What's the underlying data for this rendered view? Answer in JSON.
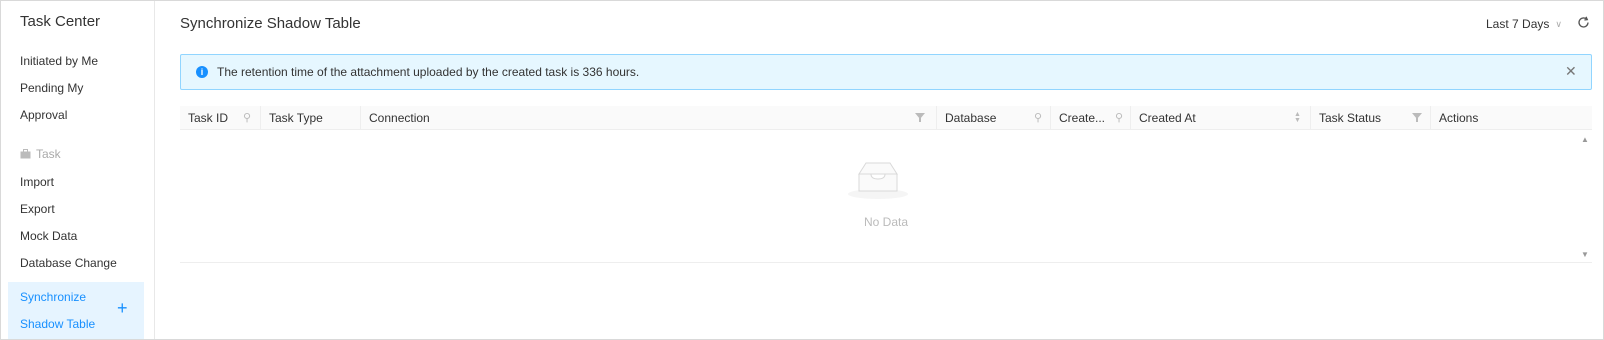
{
  "sidebar": {
    "title": "Task Center",
    "items": [
      {
        "label": "Initiated by Me"
      },
      {
        "label": "Pending My"
      },
      {
        "label": "Approval"
      }
    ],
    "group": {
      "label": "Task",
      "icon": "briefcase-icon"
    },
    "task_items": [
      {
        "label": "Import"
      },
      {
        "label": "Export"
      },
      {
        "label": "Mock Data"
      },
      {
        "label": "Database Change"
      }
    ],
    "active": {
      "line1": "Synchronize",
      "line2": "Shadow Table",
      "add_icon": "plus-icon"
    }
  },
  "header": {
    "title": "Synchronize Shadow Table",
    "time_range": "Last 7 Days",
    "refresh_icon": "refresh-icon"
  },
  "alert": {
    "message": "The retention time of the attachment uploaded by the created task is 336 hours.",
    "info_icon": "info-icon",
    "close_icon": "close-icon"
  },
  "table": {
    "columns": [
      {
        "label": "Task ID",
        "icon": "search-icon"
      },
      {
        "label": "Task Type"
      },
      {
        "label": "Connection",
        "icon": "filter-icon"
      },
      {
        "label": "Database",
        "icon": "search-icon"
      },
      {
        "label": "Create...",
        "icon": "search-icon"
      },
      {
        "label": "Created At",
        "icon": "sort-icon"
      },
      {
        "label": "Task Status",
        "icon": "filter-icon"
      },
      {
        "label": "Actions"
      }
    ],
    "rows": [],
    "empty_text": "No Data"
  },
  "colors": {
    "accent": "#1890ff",
    "alert_bg": "#e6f7ff",
    "alert_border": "#91d5ff",
    "active_bg": "#e6f4ff"
  }
}
